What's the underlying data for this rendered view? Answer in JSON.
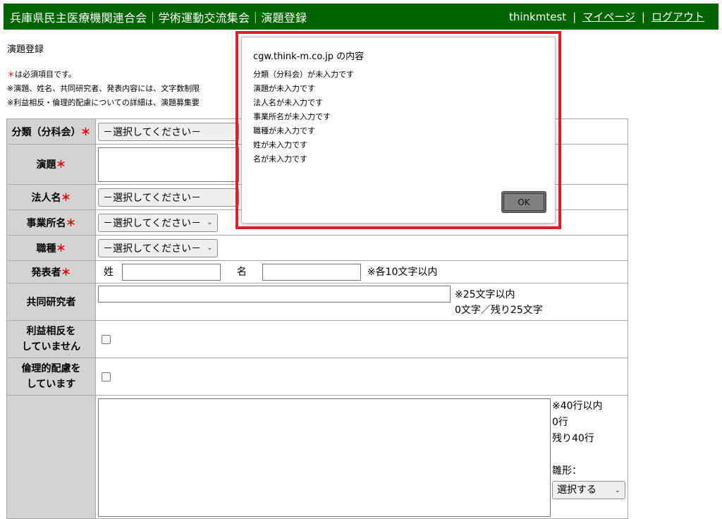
{
  "header": {
    "title": "兵庫県民主医療機関連合会｜学術運動交流集会｜演題登録",
    "username": "thinkmtest",
    "separator": "|",
    "mypage": "マイページ",
    "logout": "ログアウト"
  },
  "page_title": "演題登録",
  "notes": {
    "required_mark": "＊",
    "required_text": "は必須項目です。",
    "line2": "※演題、姓名、共同研究者、発表内容には、文字数制限",
    "line3": "※利益相反・倫理的配慮についての詳細は、演題募集要"
  },
  "form": {
    "required_mark": "＊",
    "category": {
      "label": "分類（分科会）",
      "value": "－選択してください－"
    },
    "subject": {
      "label": "演題"
    },
    "corporation": {
      "label": "法人名",
      "value": "－選択してください－"
    },
    "office": {
      "label": "事業所名",
      "value": "－選択してください－"
    },
    "occupation": {
      "label": "職種",
      "value": "－選択してください－"
    },
    "presenter": {
      "label": "発表者",
      "last_name_label": "姓",
      "first_name_label": "名",
      "hint": "※各10文字以内"
    },
    "coresearchers": {
      "label": "共同研究者",
      "hint": "※25文字以内",
      "counter": "0文字／残り25文字"
    },
    "coi": {
      "label_line1": "利益相反を",
      "label_line2": "していません"
    },
    "ethics": {
      "label_line1": "倫理的配慮を",
      "label_line2": "しています"
    },
    "content": {
      "hint": "※40行以内",
      "lines": "0行",
      "remaining": "残り40行",
      "template_label": "雛形：",
      "template_value": "選択する"
    }
  },
  "dialog": {
    "origin": "cgw.think-m.co.jp の内容",
    "messages": [
      "分類（分科会）が未入力です",
      "演題が未入力です",
      "法人名が未入力です",
      "事業所名が未入力です",
      "職種が未入力です",
      "姓が未入力です",
      "名が未入力です"
    ],
    "ok_label": "OK"
  },
  "colors": {
    "header_bg": "#006400",
    "label_bg": "#d3d3d3",
    "required": "#e00000",
    "highlight": "#e0202a"
  }
}
